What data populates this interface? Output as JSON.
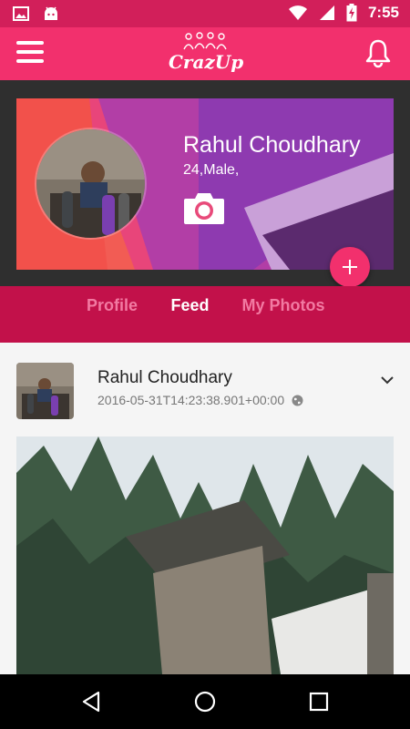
{
  "status_bar": {
    "time": "7:55",
    "icons": [
      "image-icon",
      "android-icon",
      "wifi-icon",
      "signal-icon",
      "battery-charging-icon"
    ]
  },
  "app_bar": {
    "logo_text": "CrazUp",
    "icons": [
      "menu-icon",
      "bell-icon"
    ]
  },
  "profile": {
    "name": "Rahul Choudhary",
    "meta": "24,Male,",
    "icons": [
      "camera-icon",
      "add-icon"
    ]
  },
  "tabs": [
    {
      "label": "Profile",
      "active": false
    },
    {
      "label": "Feed",
      "active": true
    },
    {
      "label": "My Photos",
      "active": false
    }
  ],
  "feed": {
    "post": {
      "author": "Rahul Choudhary",
      "timestamp": "2016-05-31T14:23:38.901+00:00",
      "icons": [
        "globe-icon",
        "chevron-down-icon"
      ]
    }
  },
  "nav_bar": {
    "icons": [
      "back-icon",
      "home-icon",
      "recents-icon"
    ]
  },
  "colors": {
    "brand_pink": "#f2306d",
    "status_bar": "#d21f5a",
    "tab_bar": "#c2114a",
    "header_bg": "#2f2f2f"
  }
}
